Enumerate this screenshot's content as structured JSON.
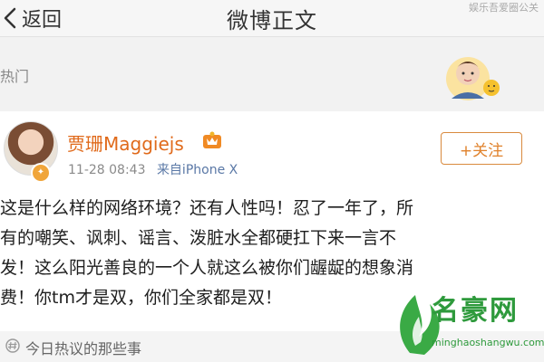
{
  "navbar": {
    "back_label": "返回",
    "title": "微博正文",
    "watermark": "娱乐吾爱圈公关"
  },
  "hot": {
    "label": "热门"
  },
  "post": {
    "username": "贾珊Maggiejs",
    "time": "11-28 08:43",
    "source": "来自iPhone X",
    "follow_label": "+关注",
    "lines": [
      "这是什么样的网络环境？还有人性吗！忍了一年了，所",
      "有的嘲笑、讽刺、谣言、泼脏水全都硬扛下来一言不",
      "发！这么阳光善良的一个人就这么被你们龌龊的想象消",
      "费！你tm才是双，你们全家都是双！"
    ]
  },
  "topic": {
    "label": "今日热议的那些事"
  },
  "site_watermark": {
    "name": "名豪网",
    "url": "minghaoshangwu.com"
  },
  "colors": {
    "username": "#e06a1b",
    "follow_border": "#d98a3e",
    "source_link": "#5a78a6",
    "watermark_green": "#2e9a3c"
  }
}
